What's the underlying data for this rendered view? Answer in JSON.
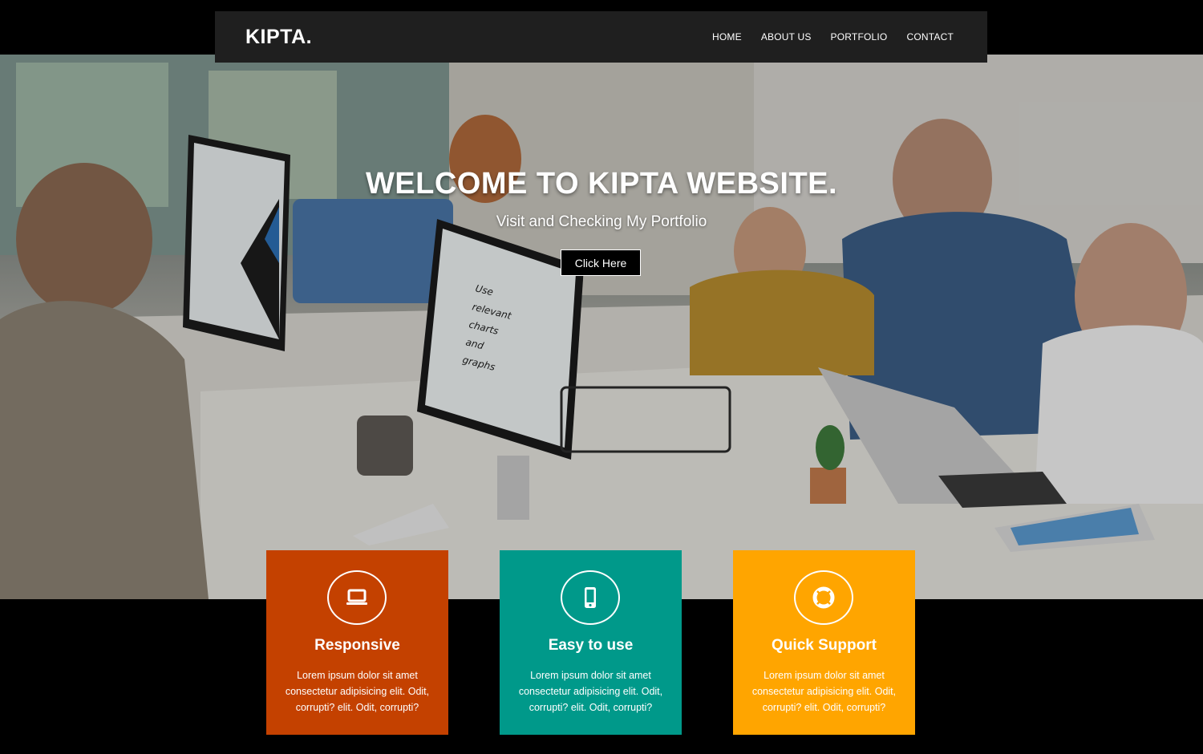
{
  "navbar": {
    "brand": "KIPTA.",
    "links": [
      "HOME",
      "ABOUT US",
      "PORTFOLIO",
      "CONTACT"
    ]
  },
  "hero": {
    "title": "WELCOME TO KIPTA WEBSITE.",
    "subtitle": "Visit and Checking My Portfolio",
    "button_label": "Click Here",
    "screen_text": [
      "Use",
      "relevant",
      "charts",
      "and",
      "graphs"
    ]
  },
  "features": [
    {
      "title": "Responsive",
      "icon": "laptop-icon",
      "text": "Lorem ipsum dolor sit amet consectetur adipisicing elit. Odit, corrupti? elit. Odit, corrupti?",
      "color": "#c44100"
    },
    {
      "title": "Easy to use",
      "icon": "mobile-icon",
      "text": "Lorem ipsum dolor sit amet consectetur adipisicing elit. Odit, corrupti? elit. Odit, corrupti?",
      "color": "#00998a"
    },
    {
      "title": "Quick Support",
      "icon": "life-ring-icon",
      "text": "Lorem ipsum dolor sit amet consectetur adipisicing elit. Odit, corrupti? elit. Odit, corrupti?",
      "color": "#ffa500"
    }
  ]
}
